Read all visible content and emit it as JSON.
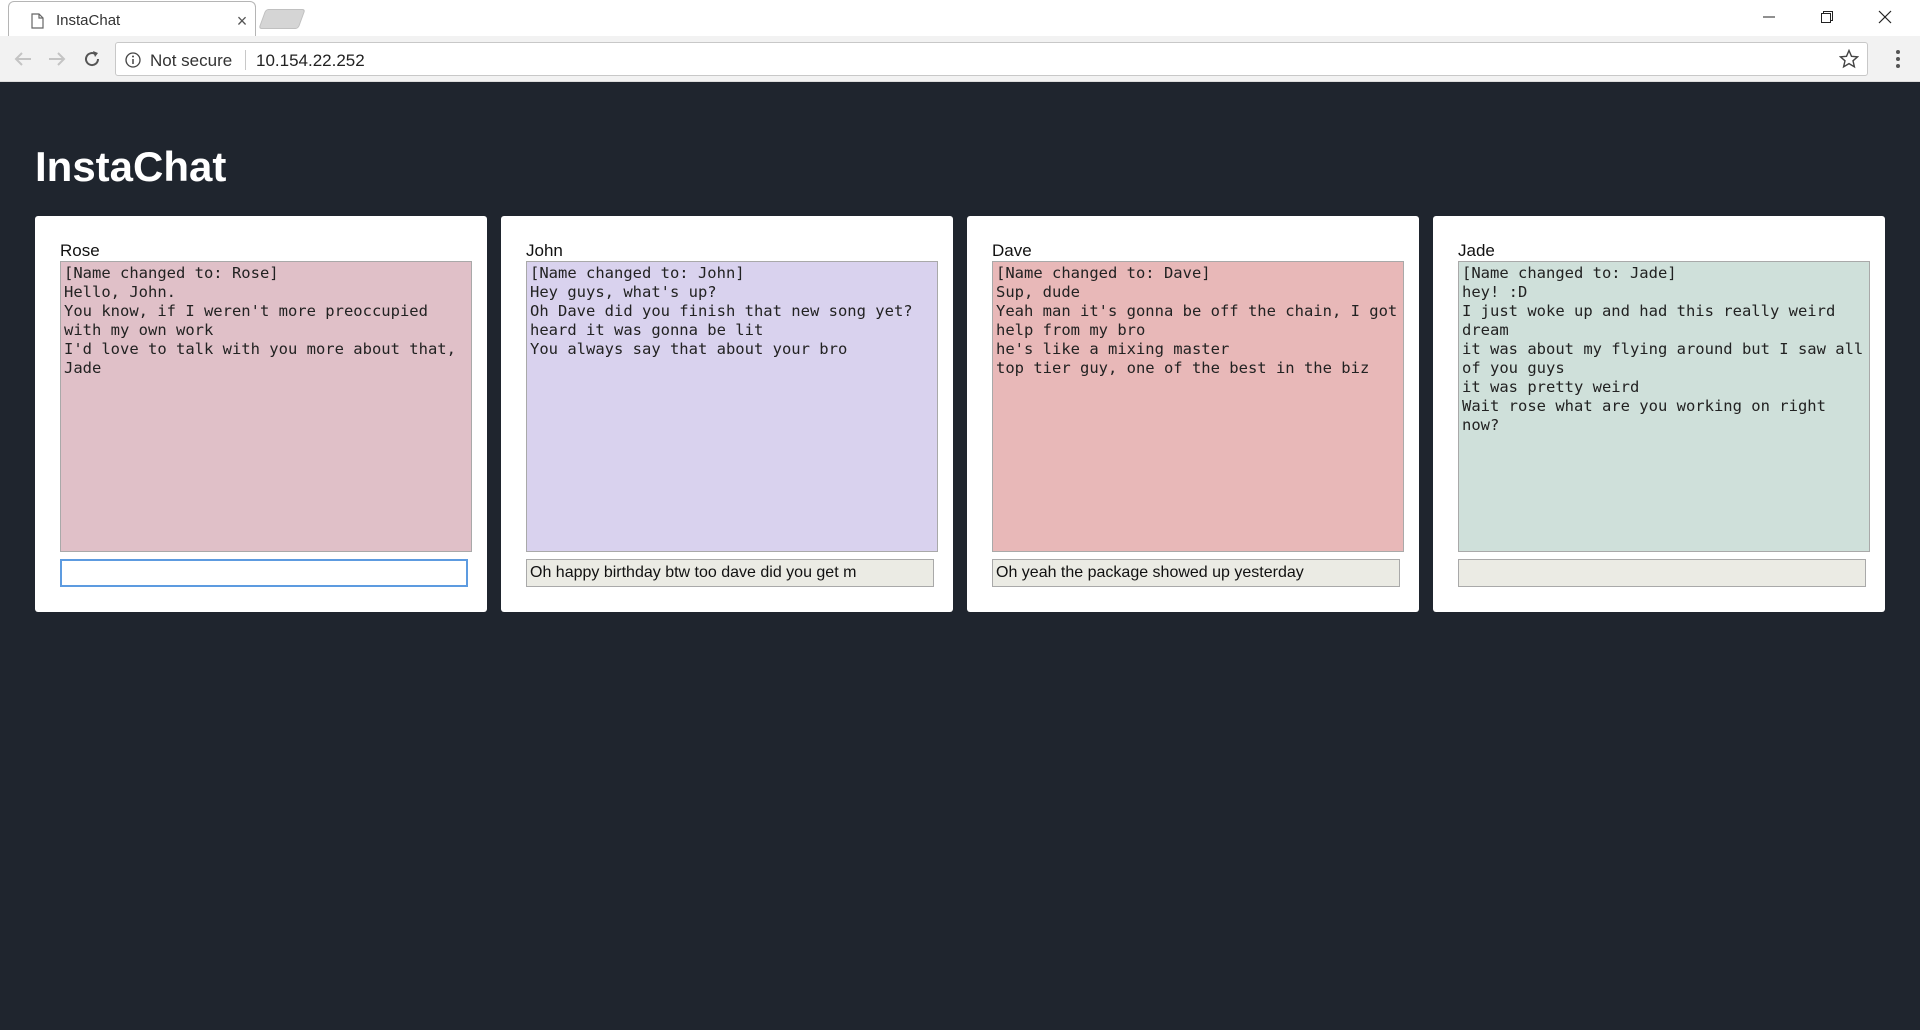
{
  "browser": {
    "tab_title": "InstaChat",
    "security_label": "Not secure",
    "url": "10.154.22.252"
  },
  "app": {
    "title": "InstaChat"
  },
  "chats": [
    {
      "name": "Rose",
      "color": "#e0c0c8",
      "messages": [
        "[Name changed to: Rose]",
        "Hello, John.",
        "You know, if I weren't more preoccupied with my own work",
        "I'd love to talk with you more about that, Jade"
      ],
      "input_value": "",
      "focused": true
    },
    {
      "name": "John",
      "color": "#d9d2ee",
      "messages": [
        "[Name changed to: John]",
        "Hey guys, what's up?",
        "Oh Dave did you finish that new song yet? heard it was gonna be lit",
        "You always say that about your bro"
      ],
      "input_value": "Oh happy birthday btw too dave did you get m",
      "focused": false
    },
    {
      "name": "Dave",
      "color": "#e8b8b8",
      "messages": [
        "[Name changed to: Dave]",
        "Sup, dude",
        "Yeah man it's gonna be off the chain, I got help from my bro",
        "he's like a mixing master",
        "top tier guy, one of the best in the biz"
      ],
      "input_value": "Oh yeah the package showed up yesterday",
      "focused": false
    },
    {
      "name": "Jade",
      "color": "#cfe0da",
      "messages": [
        "[Name changed to: Jade]",
        "hey! :D",
        "I just woke up and had this really weird dream",
        "it was about my flying around but I saw all of you guys",
        "it was pretty weird",
        "Wait rose what are you working on right now?"
      ],
      "input_value": "",
      "focused": false
    }
  ]
}
